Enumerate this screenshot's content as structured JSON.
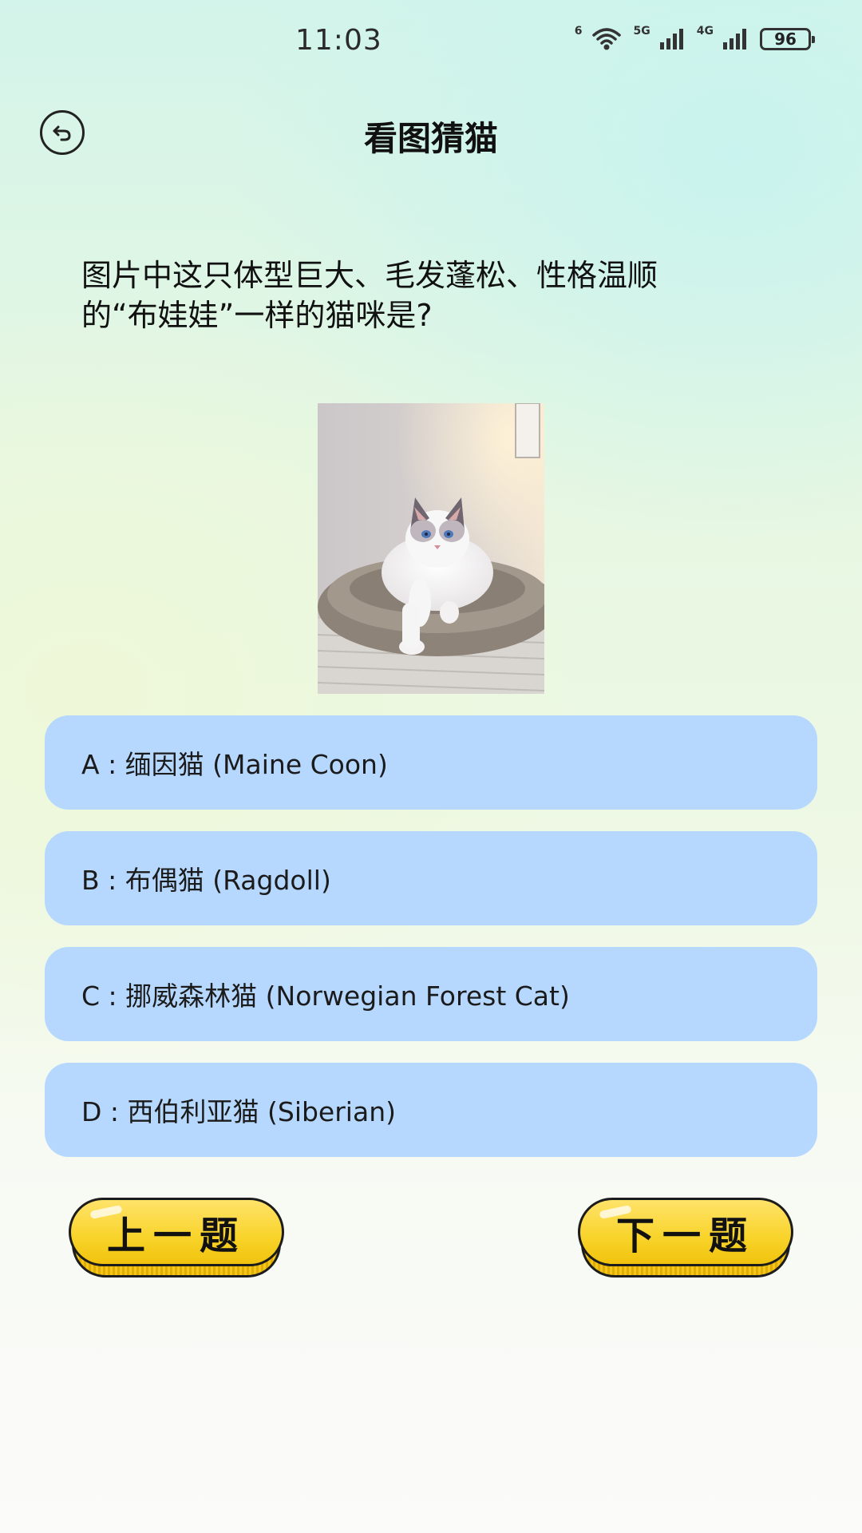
{
  "status_bar": {
    "time": "11:03",
    "wifi_label": "6",
    "network_1": "5G",
    "network_2": "4G",
    "battery": "96"
  },
  "header": {
    "title": "看图猜猫",
    "back_icon": "back-arrow-circle-icon"
  },
  "question": {
    "line1": "图片中这只体型巨大、毛发蓬松、性格温顺",
    "line2": "的“布娃娃”一样的猫咪是?"
  },
  "image": {
    "subject": "white ragdoll cat on a cushion"
  },
  "options": [
    {
      "key": "A",
      "label": "A : 缅因猫 (Maine Coon)"
    },
    {
      "key": "B",
      "label": "B : 布偶猫 (Ragdoll)"
    },
    {
      "key": "C",
      "label": "C : 挪威森林猫 (Norwegian Forest Cat)"
    },
    {
      "key": "D",
      "label": "D : 西伯利亚猫 (Siberian)"
    }
  ],
  "nav": {
    "prev_label": "上一题",
    "next_label": "下一题"
  },
  "colors": {
    "option_bg": "#b6d8ff",
    "button_yellow": "#f8d329"
  }
}
